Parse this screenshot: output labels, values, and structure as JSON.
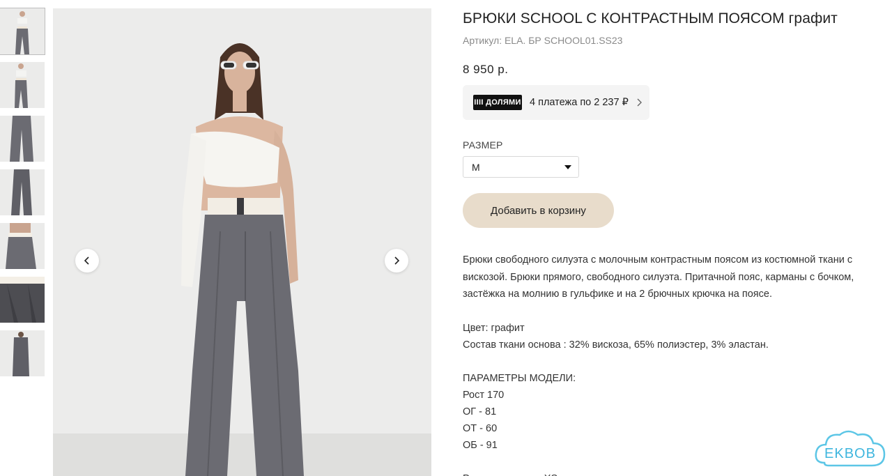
{
  "product": {
    "title": "БРЮКИ SCHOOL С КОНТРАСТНЫМ ПОЯСОМ графит",
    "sku": "Артикул: ELA. БР SCHOOL01.SS23",
    "price": "8 950 р.",
    "installments": {
      "logo_text": "IIII ДОЛЯМИ",
      "text": "4 платежа по 2 237 ₽"
    },
    "size_label": "РАЗМЕР",
    "size_selected": "M",
    "add_to_cart": "Добавить в корзину",
    "description": "Брюки свободного силуэта с молочным контрастным поясом из костюмной ткани с вискозой. Брюки прямого, свободного силуэта. Притачной пояс, карманы с бочком, застёжка на молнию в гульфике и на 2 брючных крючка на поясе.",
    "color_line": "Цвет: графит",
    "composition_line": "Состав ткани основа : 32% вискоза, 65% полиэстер, 3% эластан.",
    "model_params": {
      "heading": "ПАРАМЕТРЫ МОДЕЛИ:",
      "height": "Рост 170",
      "og": "ОГ - 81",
      "ot": "ОТ - 60",
      "ob": "ОБ - 91"
    },
    "item_size": "Размер изделия: XS"
  },
  "gallery": {
    "thumbnail_count": 7,
    "active_index": 0
  },
  "watermark": {
    "text": "EKBOB"
  },
  "colors": {
    "cart_button": "#e8dccb",
    "trousers": "#6b6b72",
    "background": "#ececeb"
  }
}
